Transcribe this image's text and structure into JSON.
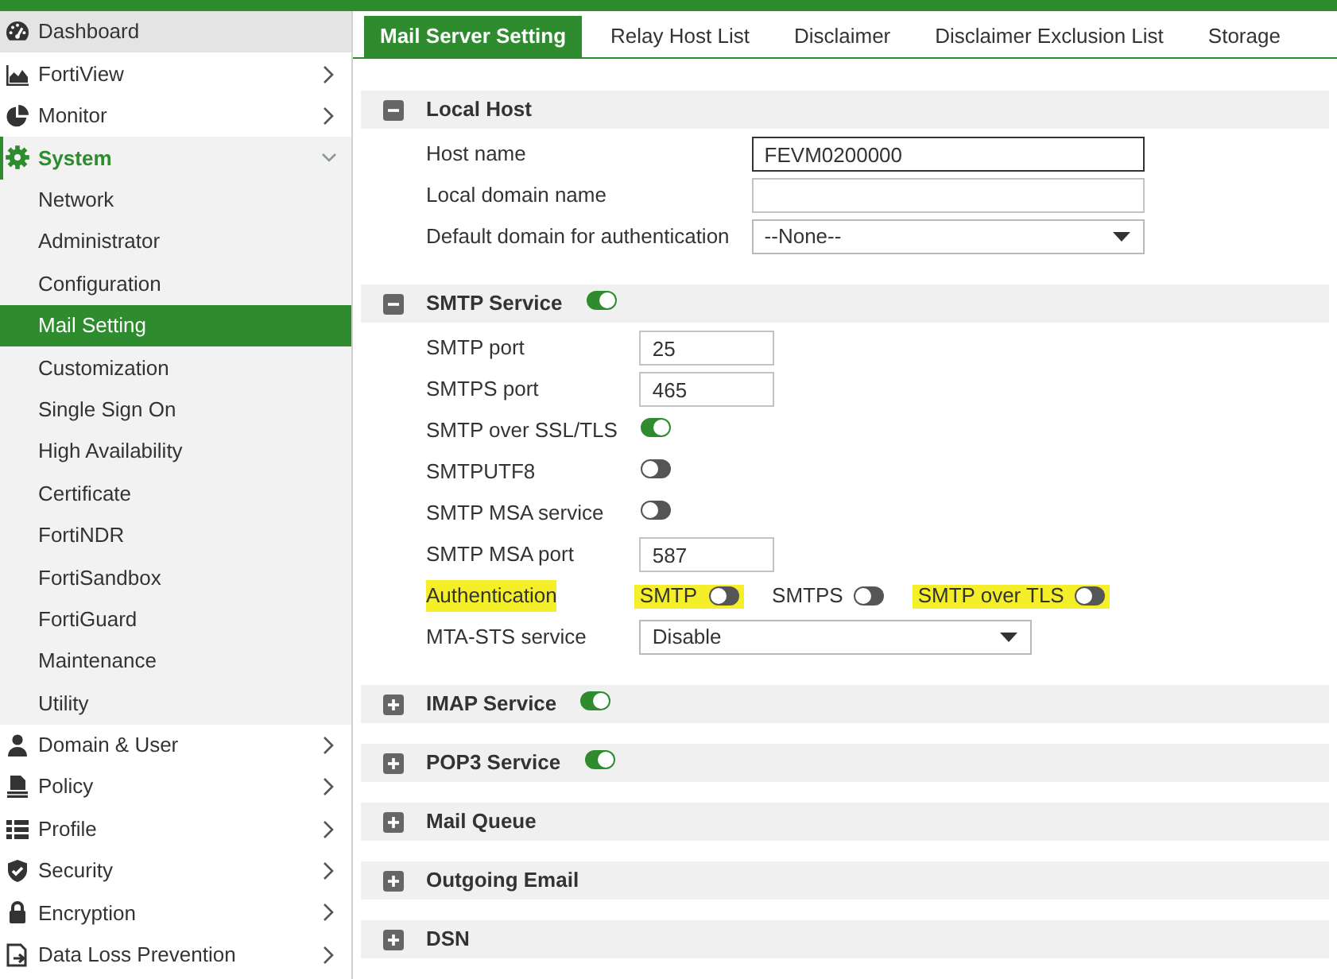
{
  "sidebar": {
    "items": [
      {
        "label": "Dashboard",
        "highlighted": true
      },
      {
        "label": "FortiView",
        "highlighted": false,
        "expanded": false
      },
      {
        "label": "Monitor",
        "highlighted": false,
        "expanded": false
      },
      {
        "label": "System",
        "highlighted": false,
        "expanded": true,
        "children": [
          {
            "label": "Network",
            "selected": false
          },
          {
            "label": "Administrator",
            "selected": false
          },
          {
            "label": "Configuration",
            "selected": false
          },
          {
            "label": "Mail Setting",
            "selected": true
          },
          {
            "label": "Customization",
            "selected": false
          },
          {
            "label": "Single Sign On",
            "selected": false
          },
          {
            "label": "High Availability",
            "selected": false
          },
          {
            "label": "Certificate",
            "selected": false
          },
          {
            "label": "FortiNDR",
            "selected": false
          },
          {
            "label": "FortiSandbox",
            "selected": false
          },
          {
            "label": "FortiGuard",
            "selected": false
          },
          {
            "label": "Maintenance",
            "selected": false
          },
          {
            "label": "Utility",
            "selected": false
          }
        ]
      },
      {
        "label": "Domain & User",
        "highlighted": false,
        "expanded": false
      },
      {
        "label": "Policy",
        "highlighted": false,
        "expanded": false
      },
      {
        "label": "Profile",
        "highlighted": false,
        "expanded": false
      },
      {
        "label": "Security",
        "highlighted": false,
        "expanded": false
      },
      {
        "label": "Encryption",
        "highlighted": false,
        "expanded": false
      },
      {
        "label": "Data Loss Prevention",
        "highlighted": false,
        "expanded": false
      }
    ]
  },
  "tabs": [
    {
      "label": "Mail Server Setting",
      "selected": true
    },
    {
      "label": "Relay Host List",
      "selected": false
    },
    {
      "label": "Disclaimer",
      "selected": false
    },
    {
      "label": "Disclaimer Exclusion List",
      "selected": false
    },
    {
      "label": "Storage",
      "selected": false
    }
  ],
  "sections": [
    {
      "title": "Local Host",
      "expanded": true,
      "rows": [
        {
          "kind": "text",
          "label": "Host name",
          "value": "FEVM0200000",
          "focused": true
        },
        {
          "kind": "text",
          "label": "Local domain name",
          "focused": false
        },
        {
          "kind": "select",
          "label": "Default domain for authentication",
          "value": "--None--"
        }
      ]
    },
    {
      "title": "SMTP Service",
      "expanded": true,
      "on": true,
      "rows": [
        {
          "kind": "number",
          "label": "SMTP port",
          "value": "25",
          "focused": false
        },
        {
          "kind": "number",
          "label": "SMTPS port",
          "value": "465",
          "focused": false
        },
        {
          "kind": "toggle",
          "label": "SMTP over SSL/TLS",
          "on": true
        },
        {
          "kind": "toggle",
          "label": "SMTPUTF8",
          "on": false
        },
        {
          "kind": "toggle",
          "label": "SMTP MSA service",
          "on": false
        },
        {
          "kind": "number",
          "label": "SMTP MSA port",
          "value": "587",
          "focused": false
        },
        {
          "kind": "options",
          "label": "Authentication",
          "highlighted": true,
          "options": [
            {
              "label": "SMTP",
              "on": false,
              "highlighted": true
            },
            {
              "label": "SMTPS",
              "on": false,
              "highlighted": false
            },
            {
              "label": "SMTP over TLS",
              "on": false,
              "highlighted": true
            }
          ]
        },
        {
          "kind": "select",
          "label": "MTA-STS service",
          "value": "Disable"
        }
      ]
    },
    {
      "title": "IMAP Service",
      "expanded": false,
      "on": true
    },
    {
      "title": "POP3 Service",
      "expanded": false,
      "on": true
    },
    {
      "title": "Mail Queue",
      "expanded": false
    },
    {
      "title": "Outgoing Email",
      "expanded": false
    },
    {
      "title": "DSN",
      "expanded": false
    }
  ]
}
